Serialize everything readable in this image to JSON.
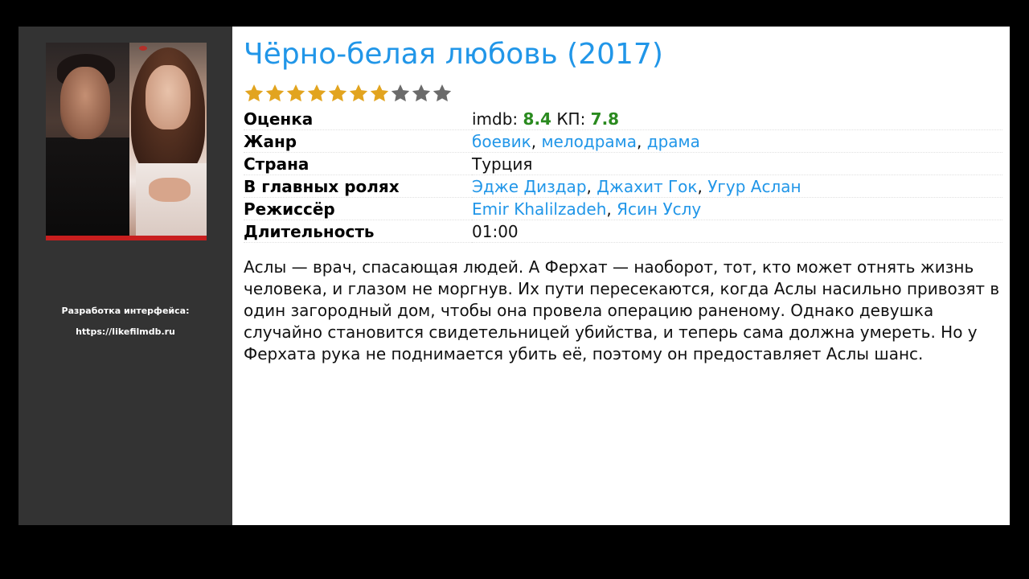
{
  "title": "Чёрно-белая любовь (2017)",
  "rating": {
    "filled": 7,
    "total": 10,
    "filled_color": "#e2a41f",
    "empty_color": "#6b6b6b"
  },
  "info": {
    "score": {
      "label": "Оценка",
      "imdb_prefix": "imdb:",
      "imdb_value": "8.4",
      "kp_prefix": "КП:",
      "kp_value": "7.8"
    },
    "genre": {
      "label": "Жанр",
      "items": [
        "боевик",
        "мелодрама",
        "драма"
      ]
    },
    "country": {
      "label": "Страна",
      "value": "Турция"
    },
    "cast": {
      "label": "В главных ролях",
      "items": [
        "Эдже Диздар",
        "Джахит Гок",
        "Угур Аслан"
      ]
    },
    "director": {
      "label": "Режиссёр",
      "items": [
        "Emir Khalilzadeh",
        "Ясин Услу"
      ]
    },
    "duration": {
      "label": "Длительность",
      "value": "01:00"
    }
  },
  "description": "Аслы — врач, спасающая людей. А Ферхат — наоборот, тот, кто может отнять жизнь человека, и глазом не моргнув. Их пути пересекаются, когда Аслы насильно привозят в один загородный дом, чтобы она провела операцию раненому. Однако девушка случайно становится свидетельницей убийства, и теперь сама должна умереть. Но у Ферхата рука не поднимается убить её, поэтому он предоставляет Аслы шанс.",
  "sidebar": {
    "credit_label": "Разработка интерфейса:",
    "credit_url": "https://likefilmdb.ru"
  },
  "colors": {
    "link": "#2196e8",
    "score": "#2a8a1f",
    "sidebar_bg": "#333333"
  }
}
